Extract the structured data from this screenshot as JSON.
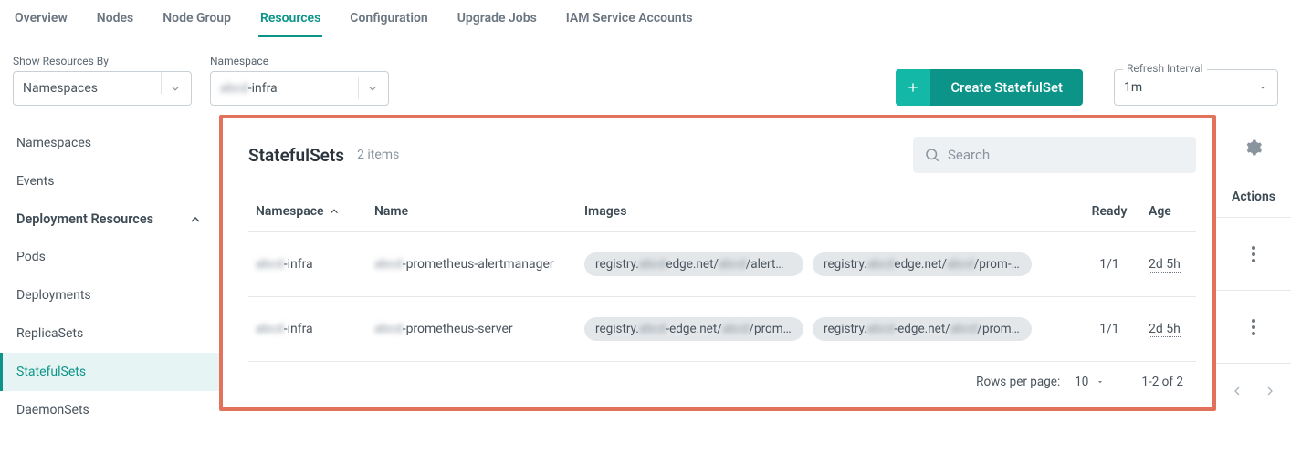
{
  "tabs": [
    "Overview",
    "Nodes",
    "Node Group",
    "Resources",
    "Configuration",
    "Upgrade Jobs",
    "IAM Service Accounts"
  ],
  "activeTab": "Resources",
  "filters": {
    "showByLabel": "Show Resources By",
    "showByValue": "Namespaces",
    "namespaceLabel": "Namespace",
    "namespaceValue": "▨▨▨-infra"
  },
  "createButton": "Create StatefulSet",
  "refresh": {
    "label": "Refresh Interval",
    "value": "1m"
  },
  "sidebar": {
    "top": [
      "Namespaces",
      "Events"
    ],
    "groupLabel": "Deployment Resources",
    "items": [
      "Pods",
      "Deployments",
      "ReplicaSets",
      "StatefulSets",
      "DaemonSets"
    ],
    "selected": "StatefulSets"
  },
  "panel": {
    "title": "StatefulSets",
    "count": "2 items",
    "searchPlaceholder": "Search"
  },
  "columns": {
    "namespace": "Namespace",
    "name": "Name",
    "images": "Images",
    "ready": "Ready",
    "age": "Age",
    "actions": "Actions"
  },
  "rows": [
    {
      "namespace_blur": "abcd",
      "namespace_suffix": "-infra",
      "name_blur": "abcd",
      "name_suffix": "-prometheus-alertmanager",
      "images": [
        {
          "pre": "registry.",
          "blur": "abcd",
          "mid": "edge.net/",
          "blur2": "abcd",
          "post": "/alertma…"
        },
        {
          "pre": "registry.",
          "blur": "abcd",
          "mid": "edge.net/",
          "blur2": "abcd",
          "post": "/prom-co…"
        }
      ],
      "ready": "1/1",
      "age": "2d 5h"
    },
    {
      "namespace_blur": "abcd",
      "namespace_suffix": "-infra",
      "name_blur": "abcd",
      "name_suffix": "-prometheus-server",
      "images": [
        {
          "pre": "registry.",
          "blur": "abcd",
          "mid": "-edge.net/",
          "blur2": "abcd",
          "post": "/prom-co…"
        },
        {
          "pre": "registry.",
          "blur": "abcd",
          "mid": "-edge.net/",
          "blur2": "abcd",
          "post": "/prometh…"
        }
      ],
      "ready": "1/1",
      "age": "2d 5h"
    }
  ],
  "pagination": {
    "rowsPerPageLabel": "Rows per page:",
    "rowsPerPageValue": "10",
    "range": "1-2 of 2"
  }
}
